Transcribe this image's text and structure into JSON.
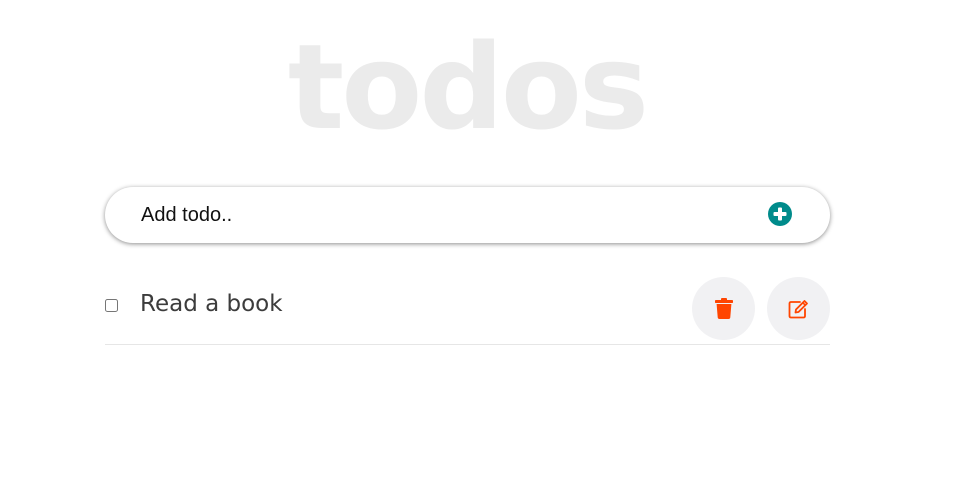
{
  "header": {
    "title": "todos"
  },
  "add_todo": {
    "placeholder": "Add todo..",
    "add_icon": "plus-circle-icon",
    "accent_color": "#008b8b"
  },
  "todos": [
    {
      "text": "Read a book",
      "completed": false,
      "delete_icon": "trash-icon",
      "edit_icon": "edit-icon",
      "action_color": "#ff4500"
    }
  ]
}
